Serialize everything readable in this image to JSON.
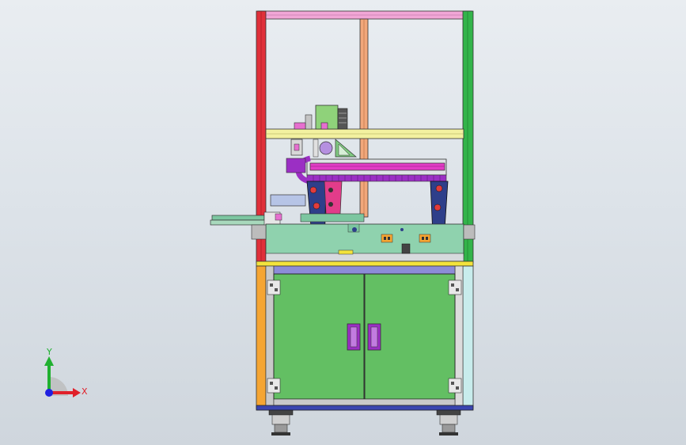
{
  "triad": {
    "x_label": "X",
    "y_label": "Y"
  },
  "colors": {
    "background_top": "#e9edf1",
    "background_bottom": "#cfd6dd",
    "frame_left": "#e0303a",
    "frame_right": "#33b44a",
    "frame_top": "#f2a6d6",
    "frame_center_post": "#f1a77a",
    "shelf": "#f3f1a0",
    "plate": "#8fd2ae",
    "cabinet_door": "#63bf63",
    "cabinet_left_post": "#f5a533",
    "cabinet_right_post": "#c8ecec",
    "door_handle": "#9b2fc4",
    "gantry_beam": "#e23cc6",
    "gantry_leg": "#2e3f8a",
    "axis_x": "#e0202a",
    "axis_y": "#20b030",
    "axis_z": "#2020e0"
  }
}
